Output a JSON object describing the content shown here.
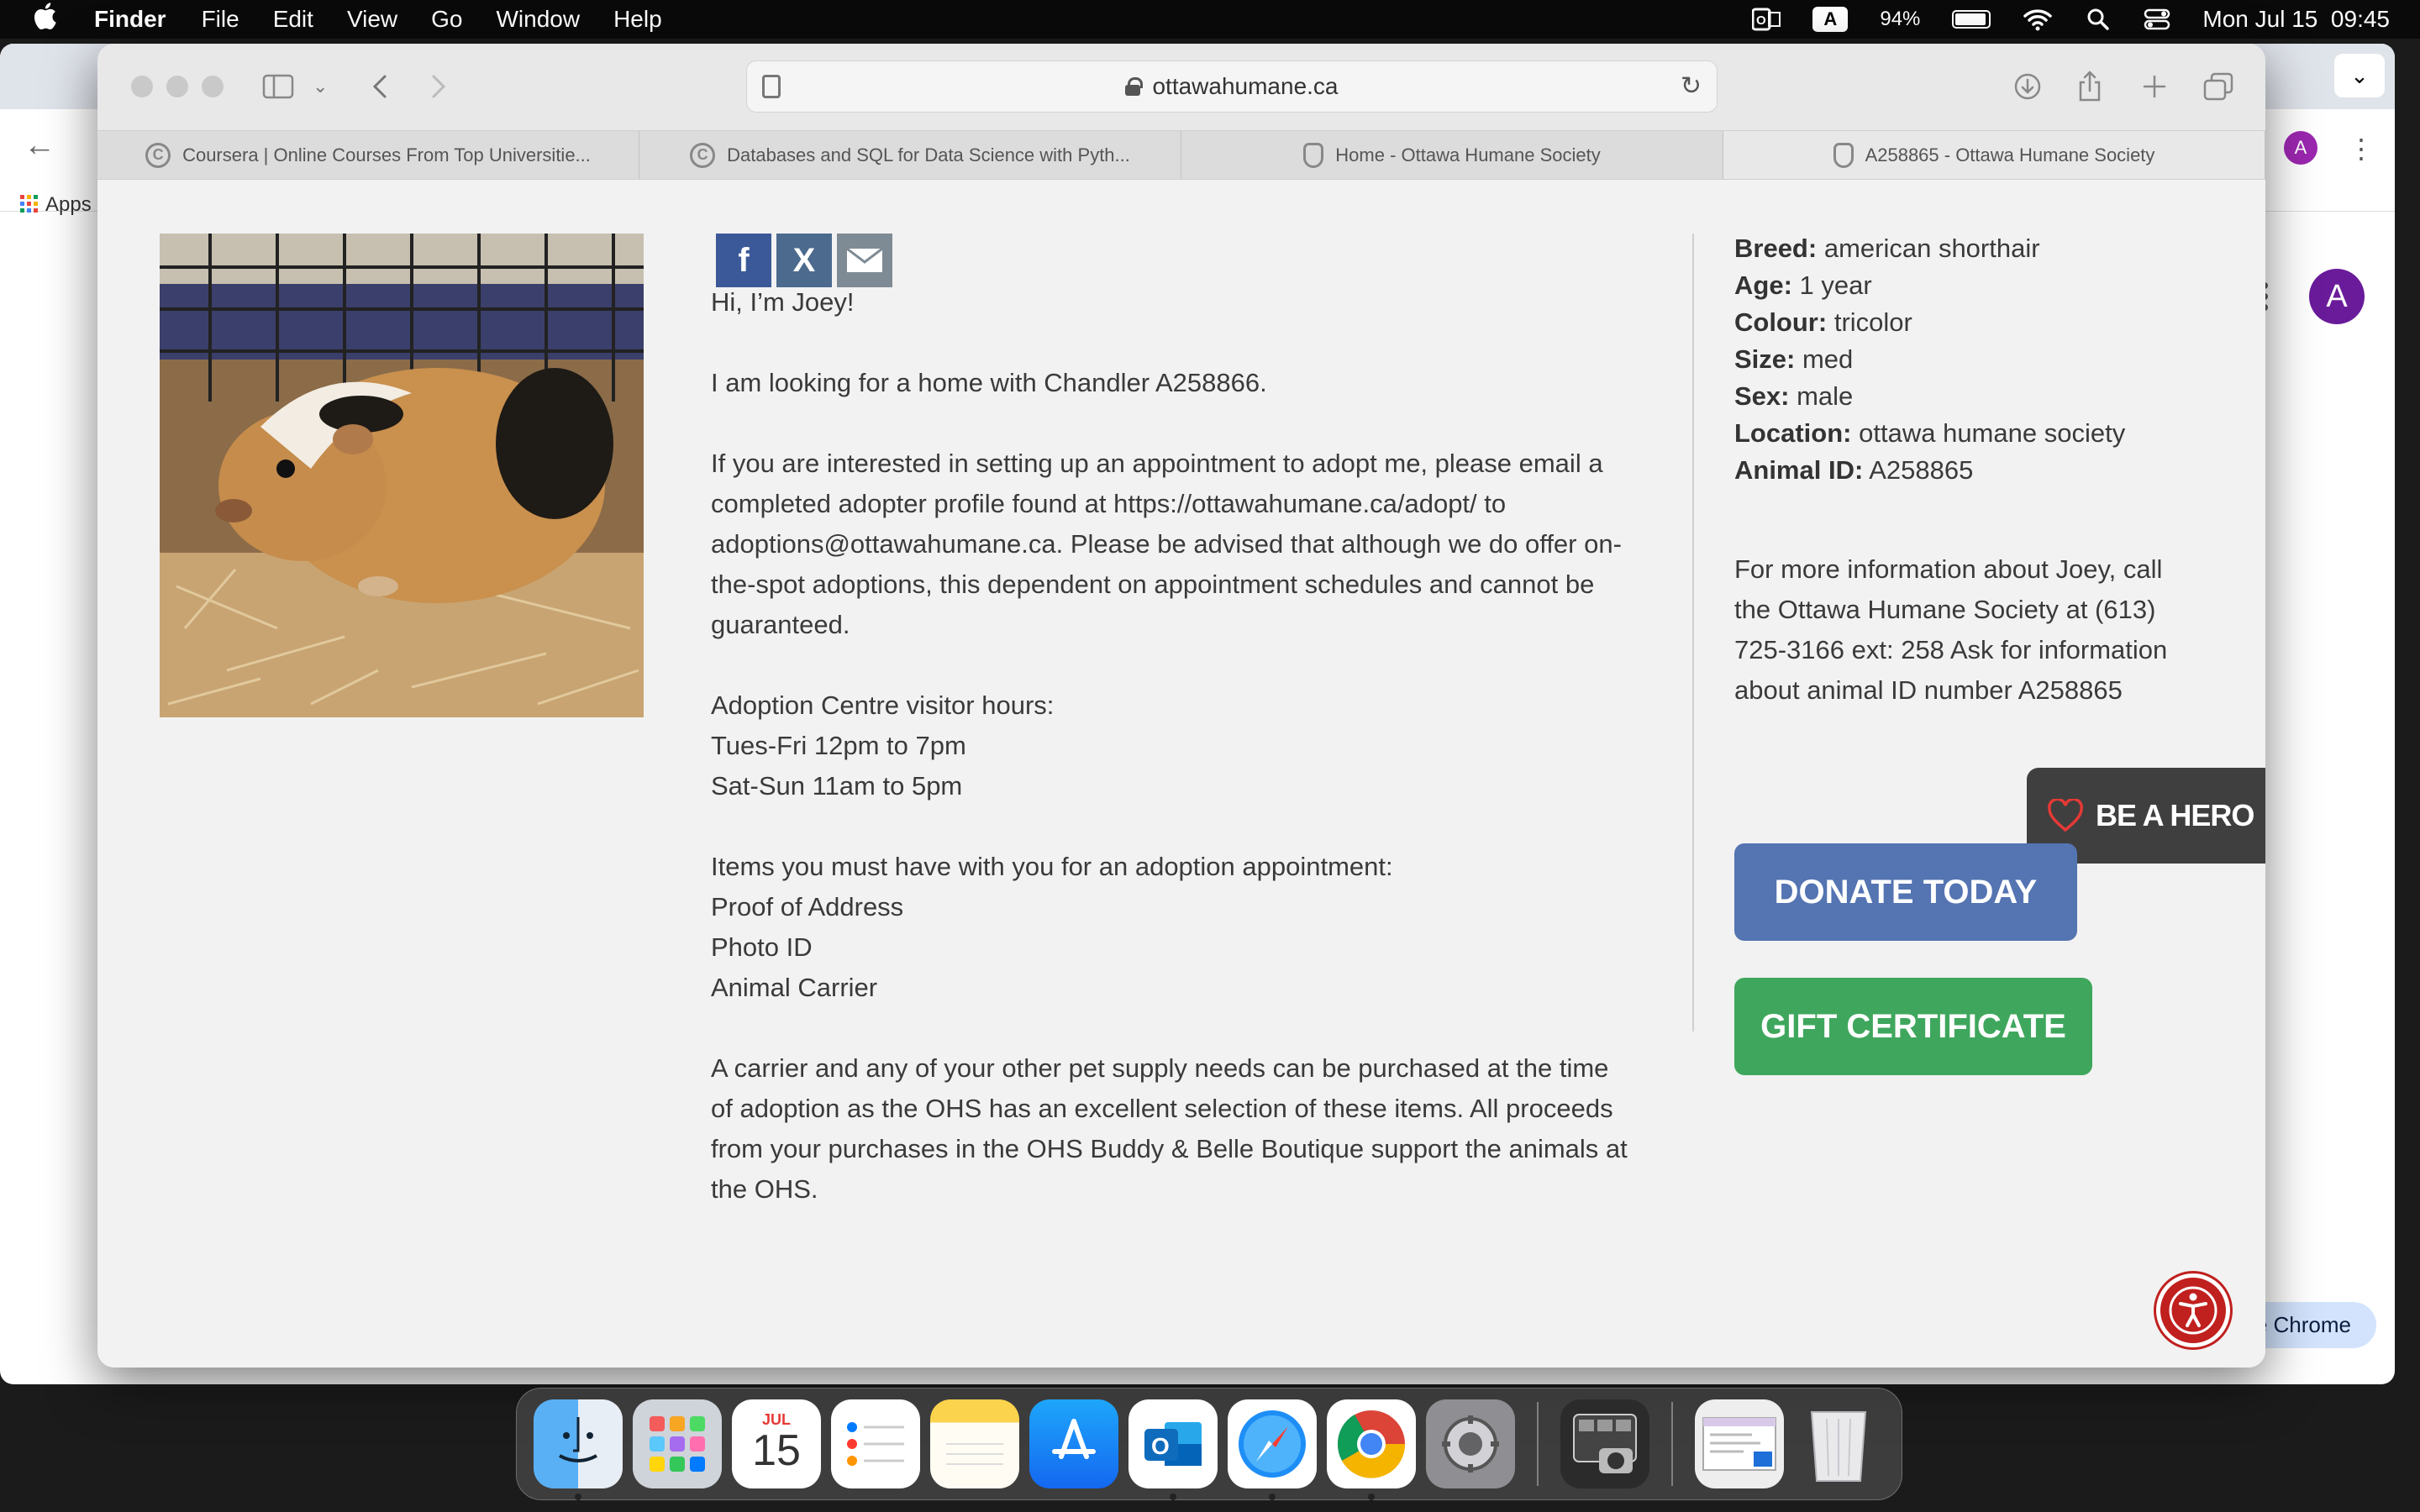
{
  "menubar": {
    "app_name": "Finder",
    "menus": [
      "File",
      "Edit",
      "View",
      "Go",
      "Window",
      "Help"
    ],
    "input_badge": "A",
    "battery": "94%",
    "datetime": "Mon Jul 15  09:45"
  },
  "background_chrome": {
    "apps_label": "Apps",
    "avatar": "A",
    "use_chrome_label": "e Chrome"
  },
  "browser": {
    "url": "ottawahumane.ca",
    "tabs": [
      {
        "title": "Coursera | Online Courses From Top Universitie...",
        "icon": "coursera-icon"
      },
      {
        "title": "Databases and SQL for Data Science with Pyth...",
        "icon": "coursera-icon"
      },
      {
        "title": "Home - Ottawa Humane Society",
        "icon": "shield-icon"
      },
      {
        "title": "A258865 - Ottawa Humane Society",
        "icon": "shield-icon"
      }
    ]
  },
  "page": {
    "greeting": "Hi, I’m Joey!",
    "looking": "I am looking for a home with Chandler A258866.",
    "interest": "If you are interested in setting up an appointment to adopt me, please email a completed adopter profile found at https://ottawahumane.ca/adopt/ to adoptions@ottawahumane.ca. Please be advised that although we do offer on-the-spot adoptions, this dependent on appointment schedules and cannot be guaranteed.",
    "hours_title": "Adoption Centre visitor hours:",
    "hours_1": "Tues-Fri 12pm to 7pm",
    "hours_2": "Sat-Sun 11am to 5pm",
    "items_title": "Items you must have with you for an adoption appointment:",
    "item_1": "Proof of Address",
    "item_2": "Photo ID",
    "item_3": "Animal Carrier",
    "carrier_note": "A carrier and any of your other pet supply needs can be purchased at the time of adoption as the OHS has an excellent selection of these items. All proceeds from your purchases in the OHS Buddy & Belle Boutique support the animals at the OHS.",
    "facts": {
      "breed_label": "Breed:",
      "breed": "american shorthair",
      "age_label": "Age:",
      "age": "1 year",
      "colour_label": "Colour:",
      "colour": "tricolor",
      "size_label": "Size:",
      "size": "med",
      "sex_label": "Sex:",
      "sex": "male",
      "location_label": "Location:",
      "location": "ottawa humane society",
      "id_label": "Animal ID:",
      "id": "A258865"
    },
    "more_info": "For more information about Joey, call the Ottawa Humane Society at (613) 725-3166 ext: 258 Ask for information about animal ID number A258865",
    "hero_label": "BE A HERO",
    "donate_label": "DONATE TODAY",
    "gift_label": "GIFT CERTIFICATE",
    "share": {
      "fb": "f",
      "x": "X"
    }
  },
  "dock": {
    "calendar_month": "JUL",
    "calendar_day": "15",
    "apps": [
      "Finder",
      "Launchpad",
      "Calendar",
      "Reminders",
      "Notes",
      "App Store",
      "Outlook",
      "Safari",
      "Chrome",
      "System Settings",
      "Screenshot",
      "Preview",
      "Trash"
    ]
  }
}
